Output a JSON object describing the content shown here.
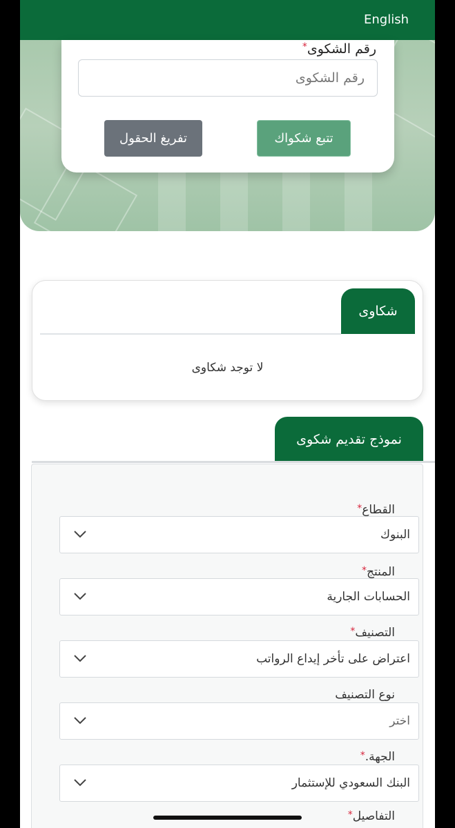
{
  "header": {
    "language_link": "English"
  },
  "track": {
    "label": "رقم الشكوى",
    "required_mark": "*",
    "input_placeholder": "رقم الشكوى",
    "track_button": "تتبع شكواك",
    "clear_button": "تفريغ الحقول"
  },
  "complaints": {
    "tab_label": "شكاوى",
    "empty_message": "لا توجد شكاوى"
  },
  "form": {
    "tab_label": "نموذج تقديم شكوى",
    "fields": [
      {
        "label": "القطاع",
        "required": "*",
        "value": "البنوك"
      },
      {
        "label": "المنتج",
        "required": "*",
        "value": "الحسابات الجارية"
      },
      {
        "label": "التصنيف",
        "required": "*",
        "value": "اعتراض على تأخر إيداع الرواتب"
      },
      {
        "label": "نوع التصنيف",
        "required": "",
        "value": "اختر"
      },
      {
        "label": "الجهة.",
        "required": "*",
        "value": "البنك السعودي للإستثمار"
      }
    ],
    "details_label": "التفاصيل",
    "details_required": "*"
  },
  "colors": {
    "brand_green": "#0b6b3a",
    "track_button": "#5aa27c",
    "clear_button": "#6b727a",
    "required": "#d7263d"
  }
}
